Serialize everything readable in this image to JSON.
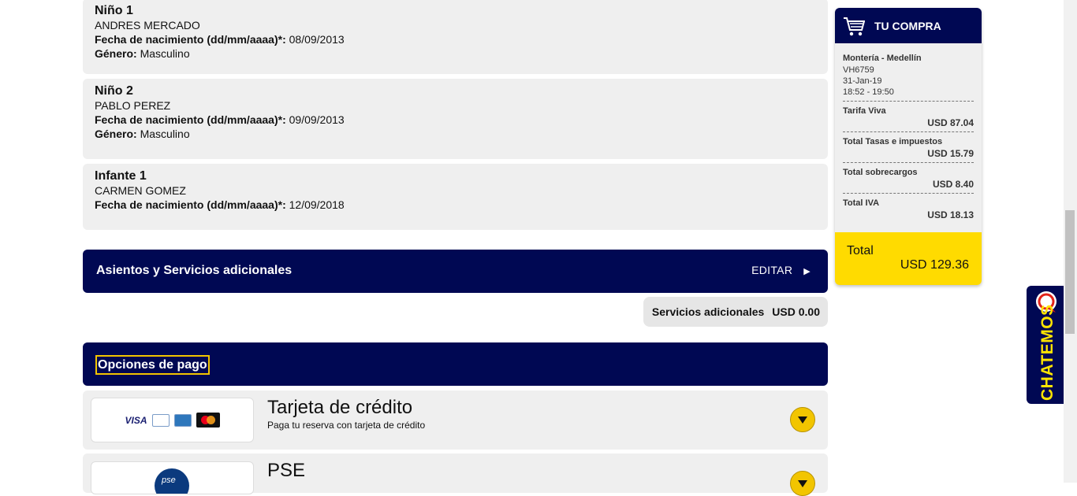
{
  "passengers": [
    {
      "title": "Niño 1",
      "name": "ANDRES MERCADO",
      "dob_label": "Fecha de nacimiento (dd/mm/aaaa)*:",
      "dob": "08/09/2013",
      "gender_label": "Género:",
      "gender": "Masculino"
    },
    {
      "title": "Niño 2",
      "name": "PABLO PEREZ",
      "dob_label": "Fecha de nacimiento (dd/mm/aaaa)*:",
      "dob": "09/09/2013",
      "gender_label": "Género:",
      "gender": "Masculino"
    },
    {
      "title": "Infante 1",
      "name": "CARMEN GOMEZ",
      "dob_label": "Fecha de nacimiento (dd/mm/aaaa)*:",
      "dob": "12/09/2018"
    }
  ],
  "services": {
    "title": "Asientos y Servicios adicionales",
    "edit_label": "EDITAR",
    "edit_icon": "triangle-right",
    "additional_label": "Servicios adicionales",
    "additional_value": "USD 0.00"
  },
  "payment": {
    "title": "Opciones de pago",
    "options": [
      {
        "name": "Tarjeta de crédito",
        "description": "Paga tu reserva con tarjeta de crédito",
        "logos": [
          "VISA",
          "Diners Club",
          "American Express",
          "Mastercard"
        ]
      },
      {
        "name": "PSE",
        "logo": "pse"
      }
    ]
  },
  "summary": {
    "title": "TU COMPRA",
    "route": "Montería - Medellín",
    "flight_number": "VH6759",
    "date": "31-Jan-19",
    "time": "18:52 - 19:50",
    "lines": [
      {
        "label": "Tarifa Viva",
        "value": "USD 87.04"
      },
      {
        "label": "Total Tasas e impuestos",
        "value": "USD 15.79"
      },
      {
        "label": "Total sobrecargos",
        "value": "USD 8.40"
      },
      {
        "label": "Total IVA",
        "value": "USD 18.13"
      }
    ],
    "total_label": "Total",
    "total_value": "USD 129.36"
  },
  "chat": {
    "label": "CHATEMOS"
  },
  "colors": {
    "navy": "#000853",
    "yellow": "#ffdb00",
    "card_bg": "#efefef"
  }
}
